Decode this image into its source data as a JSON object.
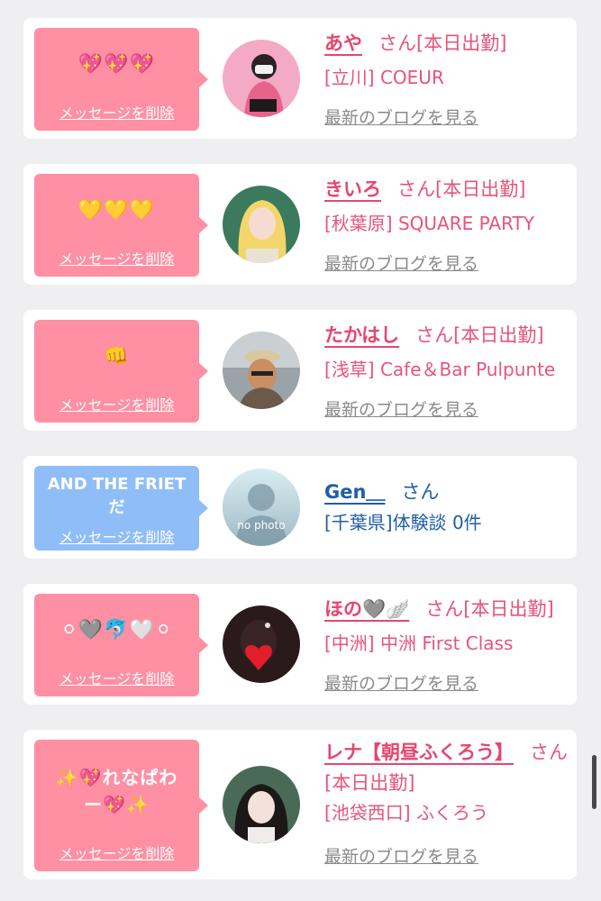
{
  "delete_label": "メッセージを削除",
  "blog_label": "最新のブログを見る",
  "san_label": "さん",
  "status_label": "[本日出勤]",
  "cards": [
    {
      "message": "💖💖💖",
      "name": "あや",
      "shop": "[立川] COEUR"
    },
    {
      "message": "💛💛💛",
      "name": "きいろ",
      "shop": "[秋葉原] SQUARE PARTY"
    },
    {
      "message": "👊",
      "name": "たかはし",
      "shop": "[浅草] Cafe＆Bar Pulpunte"
    },
    {
      "message": "AND THE FRIETだ",
      "name": "Gen＿",
      "shop": "[千葉県]体験談 0件",
      "avatar_text": "no photo"
    },
    {
      "message": "⚪🩶🐬🤍⚪",
      "name": "ほの🩶🪽",
      "shop": "[中洲] 中洲 First Class"
    },
    {
      "message": "✨💖れなぱわー💖✨",
      "name": "レナ【朝昼ふくろう】",
      "shop": "[池袋西口] ふくろう"
    }
  ]
}
